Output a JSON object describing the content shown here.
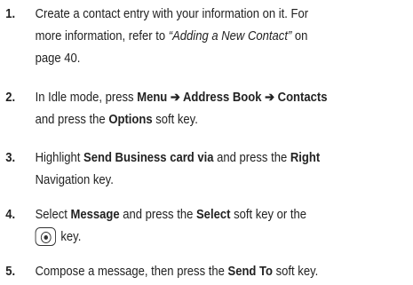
{
  "steps": [
    {
      "number": "1.",
      "line1": "Create a contact entry with your information on it. For",
      "line2a": "more information, refer to ",
      "line2_link": "“Adding a New Contact”",
      "line2b": " on",
      "line3": "page 40."
    },
    {
      "number": "2.",
      "a": "In Idle mode, press ",
      "menu": "Menu",
      "arrow1": " ➔ ",
      "address_book": "Address Book",
      "arrow2": " ➔ ",
      "contacts": "Contacts",
      "b": "and press the ",
      "options": "Options",
      "c": " soft key."
    },
    {
      "number": "3.",
      "a": "Highlight ",
      "send_business_card": "Send Business card via",
      "b": " and press the ",
      "right": "Right",
      "c": "Navigation key."
    },
    {
      "number": "4.",
      "a": "Select ",
      "message": "Message",
      "b": " and press the ",
      "select": "Select",
      "c": " soft key or the",
      "d": "key."
    },
    {
      "number": "5.",
      "a": "Compose a message, then press the ",
      "send_to": "Send To",
      "b": " soft key."
    }
  ],
  "icons": {
    "select_key": "center-select-key-icon"
  }
}
